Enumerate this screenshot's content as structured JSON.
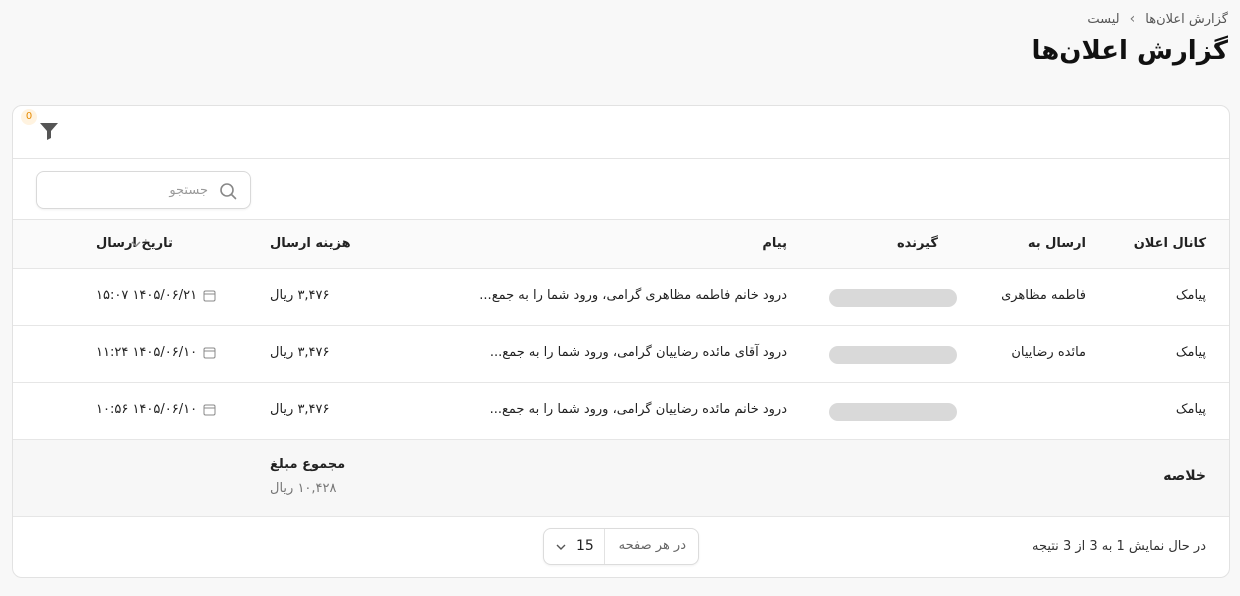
{
  "breadcrumb": {
    "parent": "گزارش اعلان‌ها",
    "current": "لیست"
  },
  "page_title": "گزارش اعلان‌ها",
  "filter": {
    "count": "0"
  },
  "search": {
    "placeholder": "جستجو",
    "value": ""
  },
  "table": {
    "headers": {
      "channel": "کانال اعلان",
      "send_to": "ارسال به",
      "receiver": "گیرنده",
      "message": "پیام",
      "cost": "هزینه ارسال",
      "date": "تاریخ ارسال"
    },
    "rows": [
      {
        "channel": "پیامک",
        "send_to": "فاطمه مظاهری",
        "message": "درود خانم فاطمه مظاهری گرامی، ورود شما را به جمع...",
        "cost": "۳,۴۷۶ ریال",
        "date": "۱۴۰۵/۰۶/۲۱ ۱۵:۰۷"
      },
      {
        "channel": "پیامک",
        "send_to": "مائده رضاییان",
        "message": "درود آقای مائده رضاییان گرامی، ورود شما را به جمع...",
        "cost": "۳,۴۷۶ ریال",
        "date": "۱۴۰۵/۰۶/۱۰ ۱۱:۲۴"
      },
      {
        "channel": "پیامک",
        "send_to": "",
        "message": "درود خانم مائده رضاییان گرامی، ورود شما را به جمع...",
        "cost": "۳,۴۷۶ ریال",
        "date": "۱۴۰۵/۰۶/۱۰ ۱۰:۵۶"
      }
    ],
    "summary": {
      "label": "خلاصه",
      "total_label": "مجموع مبلغ",
      "total_value": "۱۰,۴۲۸ ریال"
    }
  },
  "pagination": {
    "info": "در حال نمایش 1 به 3 از 3 نتیجه",
    "per_page_label": "در هر صفحه",
    "per_page_value": "15"
  },
  "colors": {
    "badge_text": "#e68a00",
    "badge_bg": "#fff3e0",
    "placeholder_pill": "#d9d9d9"
  },
  "icons": [
    "filter-icon",
    "search-icon",
    "calendar-icon",
    "sort-chevron-icon",
    "chevron-down-icon",
    "breadcrumb-chevron-icon"
  ]
}
